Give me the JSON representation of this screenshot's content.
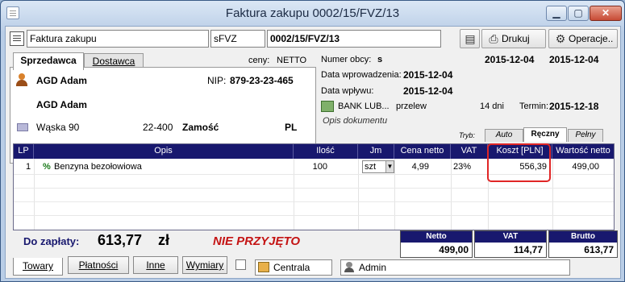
{
  "window": {
    "title": "Faktura zakupu 0002/15/FVZ/13",
    "controls": [
      "minimize",
      "maximize",
      "close"
    ]
  },
  "toolbar": {
    "doc_type": "Faktura zakupu",
    "series": "sFVZ",
    "number": "0002/15/FVZ/13",
    "print_label": "Drukuj",
    "ops_label": "Operacje.."
  },
  "tabs": {
    "seller": "Sprzedawca",
    "delivery": "Dostawca"
  },
  "prices": {
    "label": "ceny:",
    "value": "NETTO"
  },
  "seller": {
    "name1": "AGD Adam",
    "nip_label": "NIP:",
    "nip": "879-23-23-465",
    "name2": "AGD Adam",
    "street": "Wąska 90",
    "postcode": "22-400",
    "city": "Zamość",
    "country": "PL"
  },
  "details": {
    "foreign_no_label": "Numer obcy:",
    "foreign_no": "s",
    "date1": "2015-12-04",
    "date2": "2015-12-04",
    "entry_label": "Data wprowadzenia:",
    "entry_date": "2015-12-04",
    "receipt_label": "Data wpływu:",
    "receipt_date": "2015-12-04",
    "bank": "BANK LUB...",
    "payment_method": "przelew",
    "days": "14 dni",
    "due_label": "Termin:",
    "due_date": "2015-12-18",
    "description": "Opis dokumentu"
  },
  "mode": {
    "label": "Tryb:",
    "tabs": [
      "Auto",
      "Ręczny",
      "Pełny"
    ]
  },
  "grid": {
    "headers": [
      "LP",
      "Opis",
      "Ilość",
      "Jm",
      "Cena netto",
      "VAT",
      "Koszt [PLN]",
      "Wartość netto"
    ],
    "rows": [
      {
        "lp": "1",
        "mark": "%",
        "opis": "Benzyna bezołowiowa",
        "ilosc": "100",
        "jm": "szt",
        "cena": "4,99",
        "vat": "23%",
        "koszt": "556,39",
        "wartosc": "499,00"
      }
    ]
  },
  "summary": {
    "to_pay_label": "Do zapłaty:",
    "to_pay_value": "613,77",
    "currency": "zł",
    "status": "NIE PRZYJĘTO"
  },
  "totals": {
    "netto_label": "Netto",
    "netto": "499,00",
    "vat_label": "VAT",
    "vat": "114,77",
    "brutto_label": "Brutto",
    "brutto": "613,77"
  },
  "bottom_tabs": [
    "Towary",
    "Płatności",
    "Inne",
    "Wymiary"
  ],
  "status_bar": {
    "location": "Centrala",
    "user": "Admin"
  },
  "colors": {
    "grid_header": "#18186e",
    "status_red": "#c41414",
    "highlight": "#e02626"
  }
}
